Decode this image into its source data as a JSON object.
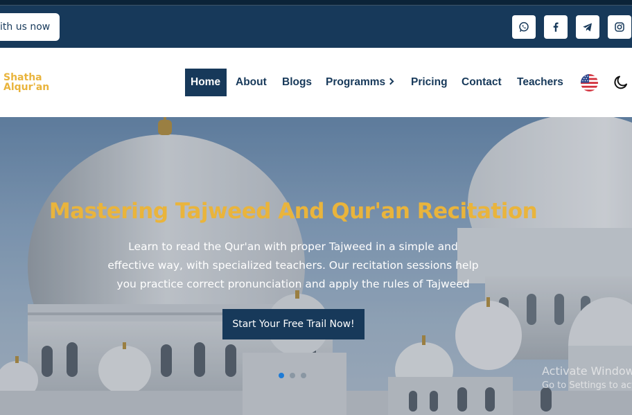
{
  "topbar": {
    "contact_label": "ith us now",
    "socials": [
      {
        "icon": "whatsapp-icon"
      },
      {
        "icon": "facebook-icon"
      },
      {
        "icon": "telegram-icon"
      },
      {
        "icon": "instagram-icon"
      }
    ]
  },
  "brand": {
    "line1": "Shatha",
    "line2": "Alqur'an",
    "color": "#e9b43c"
  },
  "nav": {
    "home": "Home",
    "about": "About",
    "blogs": "Blogs",
    "programms": "Programms",
    "pricing": "Pricing",
    "contact": "Contact",
    "teachers": "Teachers",
    "language_icon": "us-flag-icon",
    "theme_icon": "moon-icon"
  },
  "hero": {
    "title": "Mastering Tajweed And Qur'an Recitation",
    "lines": [
      "Learn to read the Qur'an with proper Tajweed in a simple and",
      "effective way, with specialized teachers. Our recitation sessions help",
      "you practice correct pronunciation and apply the rules of Tajweed"
    ],
    "cta_label": "Start Your Free Trail Now!",
    "active_slide": 1,
    "slide_count": 3
  },
  "watermark": {
    "line1": "Activate Windows",
    "line2": "Go to Settings to activate Windows."
  },
  "colors": {
    "primary": "#17395a",
    "accent": "#e9b43c",
    "dot_active": "#1e7bd6"
  }
}
